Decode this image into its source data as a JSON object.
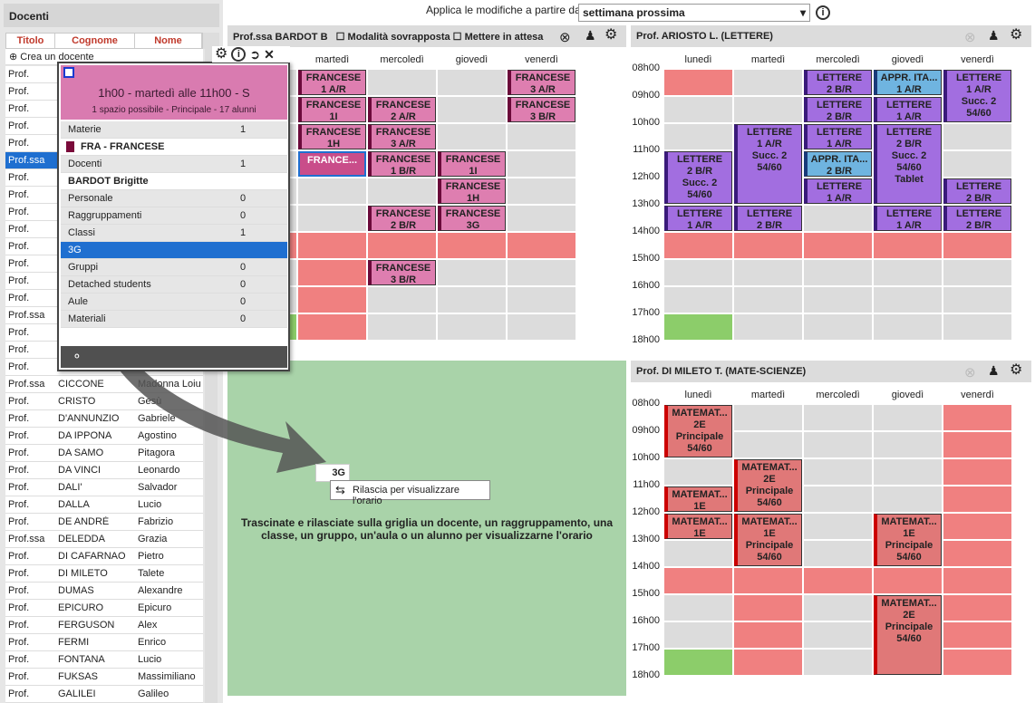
{
  "list": {
    "title": "Docenti",
    "cols": [
      "Titolo",
      "Cognome",
      "Nome"
    ],
    "create": "Crea un docente",
    "rows": [
      [
        "Prof.",
        "",
        ""
      ],
      [
        "Prof.",
        "",
        ""
      ],
      [
        "Prof.",
        "",
        ""
      ],
      [
        "Prof.",
        "",
        ""
      ],
      [
        "Prof.",
        "",
        ""
      ],
      [
        "Prof.ssa",
        "",
        ""
      ],
      [
        "Prof.",
        "",
        ""
      ],
      [
        "Prof.",
        "",
        ""
      ],
      [
        "Prof.",
        "",
        ""
      ],
      [
        "Prof.",
        "",
        ""
      ],
      [
        "Prof.",
        "",
        ""
      ],
      [
        "Prof.",
        "",
        ""
      ],
      [
        "Prof.",
        "",
        ""
      ],
      [
        "Prof.",
        "",
        ""
      ],
      [
        "Prof.ssa",
        "",
        ""
      ],
      [
        "Prof.",
        "",
        ""
      ],
      [
        "Prof.",
        "",
        ""
      ],
      [
        "Prof.",
        "",
        ""
      ],
      [
        "Prof.ssa",
        "CICCONE",
        "Madonna Loiu"
      ],
      [
        "Prof.",
        "CRISTO",
        "Gesù"
      ],
      [
        "Prof.",
        "D'ANNUNZIO",
        "Gabriele"
      ],
      [
        "Prof.",
        "DA IPPONA",
        "Agostino"
      ],
      [
        "Prof.",
        "DA SAMO",
        "Pitagora"
      ],
      [
        "Prof.",
        "DA VINCI",
        "Leonardo"
      ],
      [
        "Prof.",
        "DALI'",
        "Salvador"
      ],
      [
        "Prof.",
        "DALLA",
        "Lucio"
      ],
      [
        "Prof.",
        "DE ANDRÈ",
        "Fabrizio"
      ],
      [
        "Prof.ssa",
        "DELEDDA",
        "Grazia"
      ],
      [
        "Prof.",
        "DI CAFARNAO",
        "Pietro"
      ],
      [
        "Prof.",
        "DI MILETO",
        "Talete"
      ],
      [
        "Prof.",
        "DUMAS",
        "Alexandre"
      ],
      [
        "Prof.",
        "EPICURO",
        "Epicuro"
      ],
      [
        "Prof.",
        "FERGUSON",
        "Alex"
      ],
      [
        "Prof.",
        "FERMI",
        "Enrico"
      ],
      [
        "Prof.",
        "FONTANA",
        "Lucio"
      ],
      [
        "Prof.",
        "FUKSAS",
        "Massimiliano"
      ],
      [
        "Prof.",
        "GALILEI",
        "Galileo"
      ]
    ]
  },
  "popup": {
    "title": "1h00 - martedì alle 11h00 - S",
    "subtitle": "1 spazio possibile - Principale - 17 alunni",
    "rows": [
      [
        "Materie",
        "1",
        "g"
      ],
      [
        "FRA - FRANCESE",
        "",
        "w"
      ],
      [
        "Docenti",
        "1",
        "g"
      ],
      [
        "BARDOT Brigitte",
        "",
        "w"
      ],
      [
        "Personale",
        "0",
        "g"
      ],
      [
        "Raggruppamenti",
        "0",
        "g"
      ],
      [
        "Classi",
        "1",
        "g"
      ],
      [
        "3G",
        "",
        "s"
      ],
      [
        "Gruppi",
        "0",
        "g"
      ],
      [
        "Detached students",
        "0",
        "g"
      ],
      [
        "Aule",
        "0",
        "g"
      ],
      [
        "Materiali",
        "0",
        "g"
      ]
    ]
  },
  "top": {
    "apply": "Applica le modifiche a partire dalla",
    "week": "settimana prossima"
  },
  "p1": {
    "title": "Prof.ssa BARDOT B",
    "chk1": "Modalità sovrapposta",
    "chk2": "Mettere in attesa"
  },
  "p2": {
    "title": "Prof. ARIOSTO L. (LETTERE)"
  },
  "p3": {
    "title": "Prof. DI MILETO T. (MATE-SCIENZE)"
  },
  "days": [
    "lunedì",
    "martedì",
    "mercoledì",
    "giovedì",
    "venerdì"
  ],
  "hours": [
    "08h00",
    "09h00",
    "10h00",
    "11h00",
    "12h00",
    "13h00",
    "14h00",
    "15h00",
    "16h00",
    "17h00",
    "18h00"
  ],
  "drag": {
    "label": "3G",
    "tip": "Rilascia per visualizzare l'orario"
  },
  "hint": "Trascinate e rilasciate sulla griglia un docente, un raggruppamento, una classe, un gruppo, un'aula o un alunno per visualizzarne l'orario",
  "ev1": [
    [
      "FRANCESE\n1 A/R",
      1,
      0
    ],
    [
      "FRANCESE\n3 A/R",
      4,
      0
    ],
    [
      "FRANCESE\n1I",
      1,
      1
    ],
    [
      "FRANCESE\n2 A/R",
      2,
      1
    ],
    [
      "FRANCESE\n3 B/R",
      4,
      1
    ],
    [
      "FRANCESE\n1H",
      1,
      2
    ],
    [
      "FRANCESE\n3 A/R",
      2,
      2
    ],
    [
      "FRANCE...",
      1,
      3
    ],
    [
      "FRANCESE\n1 B/R",
      2,
      3
    ],
    [
      "FRANCESE\n1I",
      3,
      3
    ],
    [
      "FRANCESE\n1H",
      3,
      4
    ],
    [
      "FRANCESE\n2 B/R",
      2,
      5
    ],
    [
      "FRANCESE\n3G",
      3,
      5
    ],
    [
      "FRANCESE\n3 B/R",
      2,
      7
    ]
  ],
  "ev2": [
    [
      "LETTERE\n2 B/R",
      2,
      0,
      1,
      "le"
    ],
    [
      "APPR. ITA...\n1 A/R",
      3,
      0,
      1,
      "ap"
    ],
    [
      "LETTERE\n1 A/R\nSucc. 2\n54/60",
      4,
      0,
      2,
      "le"
    ],
    [
      "LETTERE\n2 B/R",
      2,
      1,
      1,
      "le"
    ],
    [
      "LETTERE\n1 A/R",
      3,
      1,
      1,
      "le"
    ],
    [
      "LETTERE\n1 A/R",
      2,
      2,
      1,
      "le"
    ],
    [
      "LETTERE\n1 A/R\nSucc. 2\n54/60",
      1,
      2,
      3,
      "le"
    ],
    [
      "LETTERE\n2 B/R\nSucc. 2\n54/60\nTablet",
      3,
      2,
      3,
      "le"
    ],
    [
      "LETTERE\n2 B/R\nSucc. 2\n54/60",
      0,
      3,
      2,
      "le"
    ],
    [
      "APPR. ITA...\n2 B/R",
      2,
      3,
      1,
      "ap"
    ],
    [
      "LETTERE\n1 A/R",
      2,
      4,
      1,
      "le"
    ],
    [
      "LETTERE\n2 B/R",
      4,
      4,
      1,
      "le"
    ],
    [
      "LETTERE\n1 A/R",
      0,
      5,
      1,
      "le"
    ],
    [
      "LETTERE\n2 B/R",
      1,
      5,
      1,
      "le"
    ],
    [
      "LETTERE\n1 A/R",
      3,
      5,
      1,
      "le"
    ],
    [
      "LETTERE\n2 B/R",
      4,
      5,
      1,
      "le"
    ]
  ],
  "ev3": [
    [
      "MATEMAT...\n2E\nPrincipale\n54/60",
      0,
      0,
      2
    ],
    [
      "MATEMAT...\n2E\nPrincipale\n54/60",
      1,
      2,
      2
    ],
    [
      "MATEMAT...\n1E",
      0,
      3,
      1
    ],
    [
      "MATEMAT...\n1E",
      0,
      4,
      1
    ],
    [
      "MATEMAT...\n1E\nPrincipale\n54/60",
      1,
      4,
      2
    ],
    [
      "MATEMAT...\n1E\nPrincipale\n54/60",
      3,
      4,
      2
    ],
    [
      "MATEMAT...\n2E\nPrincipale\n54/60",
      3,
      7,
      3
    ]
  ]
}
